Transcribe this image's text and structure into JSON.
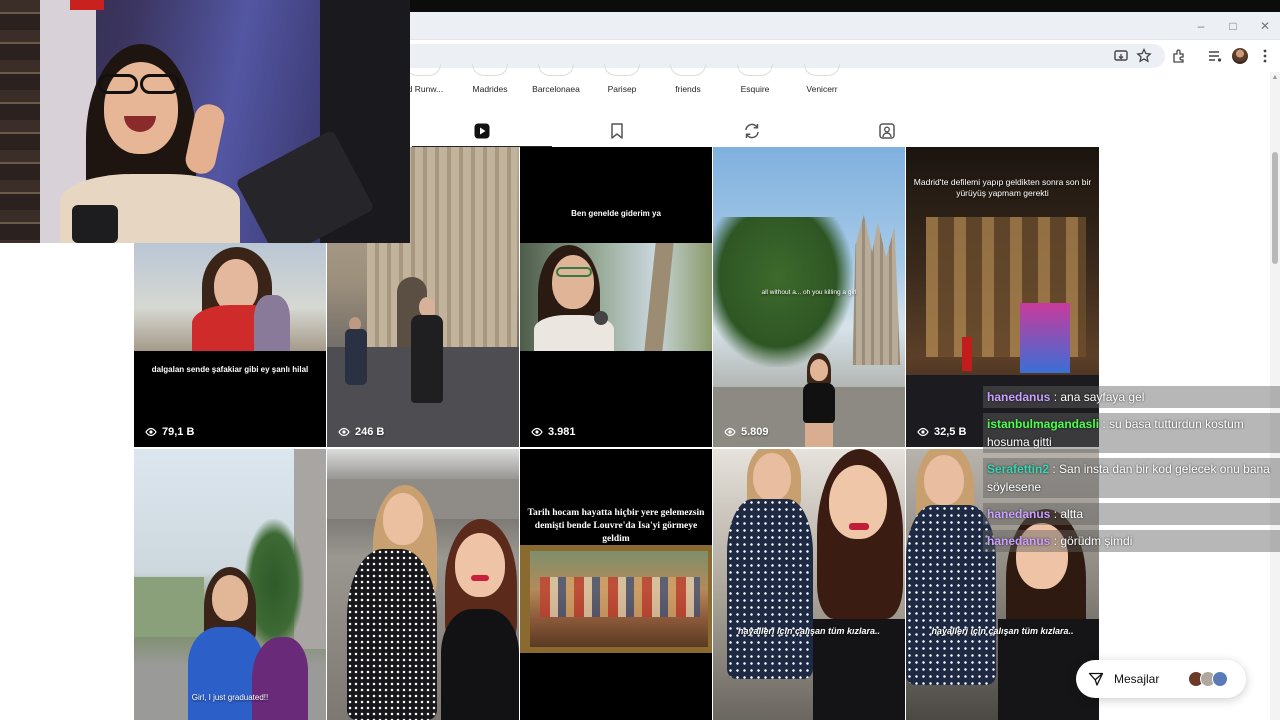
{
  "highlights": [
    {
      "label": "rid Runw..."
    },
    {
      "label": "Madrides"
    },
    {
      "label": "Barcelonaea"
    },
    {
      "label": "Parisep"
    },
    {
      "label": "friends"
    },
    {
      "label": "Esquire"
    },
    {
      "label": "Venicerr"
    }
  ],
  "profile_tabs": [
    {
      "icon": "reels-icon",
      "active": true
    },
    {
      "icon": "saved-icon",
      "active": false
    },
    {
      "icon": "reposts-icon",
      "active": false
    },
    {
      "icon": "tagged-icon",
      "active": false
    }
  ],
  "grid": {
    "row1": [
      {
        "caption": "dalgalan sende şafakiar gibi ey şanlı hilal",
        "views": "79,1 B"
      },
      {
        "caption": "",
        "views": "246 B"
      },
      {
        "caption": "Ben genelde giderim ya",
        "views": "3.981"
      },
      {
        "caption": "all without a... oh you killing a girl",
        "views": "5.809"
      },
      {
        "caption": "Madrid'te defilemi yapıp geldikten sonra son bir yürüyüş yapmam gerekti",
        "views": "32,5 B"
      }
    ],
    "row2": [
      {
        "caption": "Girl, I just graduated!!"
      },
      {
        "caption": ""
      },
      {
        "caption": "Tarih hocam hayatta hiçbir yere gelemezsin demişti bende Louvre'da Isa'yi görmeye geldim"
      },
      {
        "caption": "hayalleri için çalışan tüm kızlara.."
      },
      {
        "caption": "hayalleri için çalışan tüm kızlara.."
      }
    ]
  },
  "chat": [
    {
      "user": "hanedanus",
      "text": " : ana sayfaya gel",
      "color": "#c9a0ff"
    },
    {
      "user": "istanbulmagandasli",
      "text": " : su basa tutturdun kostum hosuma gitti",
      "color": "#4cff4c"
    },
    {
      "user": "Serafettin2",
      "text": " : San insta dan bir kod gelecek onu bana söylesene",
      "color": "#35d6b0"
    },
    {
      "user": "hanedanus",
      "text": " : altta",
      "color": "#c9a0ff"
    },
    {
      "user": "hanedanus",
      "text": " : görüdm şimdi",
      "color": "#c9a0ff"
    }
  ],
  "messages": {
    "label": "Mesajlar"
  }
}
